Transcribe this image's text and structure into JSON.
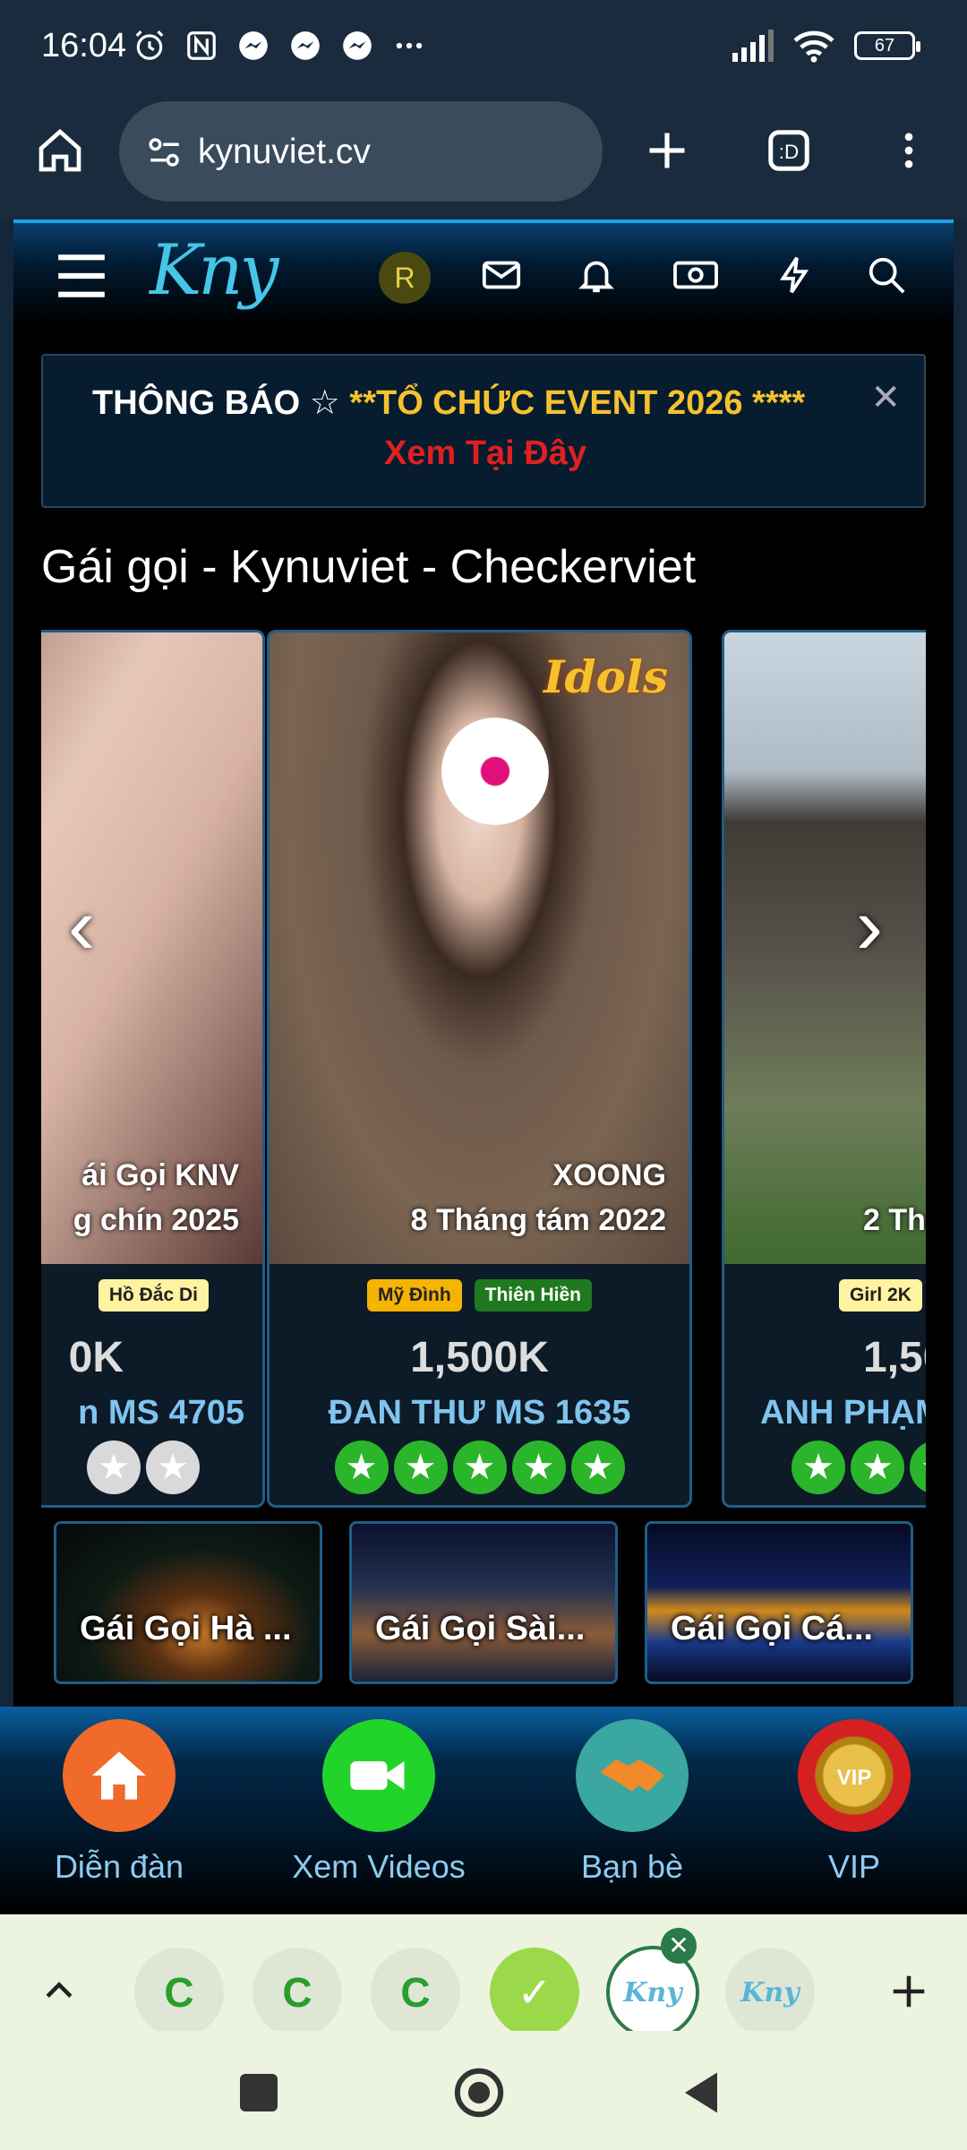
{
  "status_bar": {
    "time": "16:04",
    "battery": "67"
  },
  "browser": {
    "url": "kynuviet.cv"
  },
  "site": {
    "logo": "Kny",
    "avatar_letter": "R",
    "notice": {
      "prefix": "THÔNG BÁO ☆ ",
      "highlight": "**TỔ CHỨC EVENT 2026 ****",
      "link": "Xem Tại Đây",
      "close": "✕"
    },
    "section_title": "Gái gọi - Kynuviet - Checkerviet",
    "cards": [
      {
        "cap1": "ái Gọi KNV",
        "cap2": "g chín 2025",
        "tags": [
          "Hồ Đắc Di"
        ],
        "price": "0K",
        "name": "n MS 4705",
        "stars_green": 0,
        "stars_total": 2
      },
      {
        "cap1": "XOONG",
        "cap2": "8 Tháng tám 2022",
        "tags": [
          "Mỹ Đình",
          "Thiên Hiền"
        ],
        "price": "1,500K",
        "name": "ĐAN THƯ MS 1635",
        "stars_green": 5,
        "stars_total": 5,
        "badge": "Idols"
      },
      {
        "cap1": "",
        "cap2": "2 Thá",
        "tags": [
          "Girl 2K"
        ],
        "price": "1,50",
        "name": "ANH PHẠM",
        "stars_green": 3,
        "stars_total": 3
      }
    ],
    "regions": [
      "Gái Gọi Hà ...",
      "Gái Gọi Sài...",
      "Gái Gọi Cá..."
    ]
  },
  "bottom_nav": [
    {
      "label": "Diễn đàn",
      "icon": "home-icon",
      "color": "#f06a2a"
    },
    {
      "label": "Xem Videos",
      "icon": "video-camera-icon",
      "color": "#22d42a"
    },
    {
      "label": "Bạn bè",
      "icon": "handshake-icon",
      "color": "#3aa7a0"
    },
    {
      "label": "VIP",
      "icon": "vip-badge-icon",
      "color": "#d42020"
    }
  ],
  "tab_strip": {
    "tabs": [
      "C",
      "C",
      "C",
      "✓",
      "Kny",
      "Kny"
    ]
  }
}
